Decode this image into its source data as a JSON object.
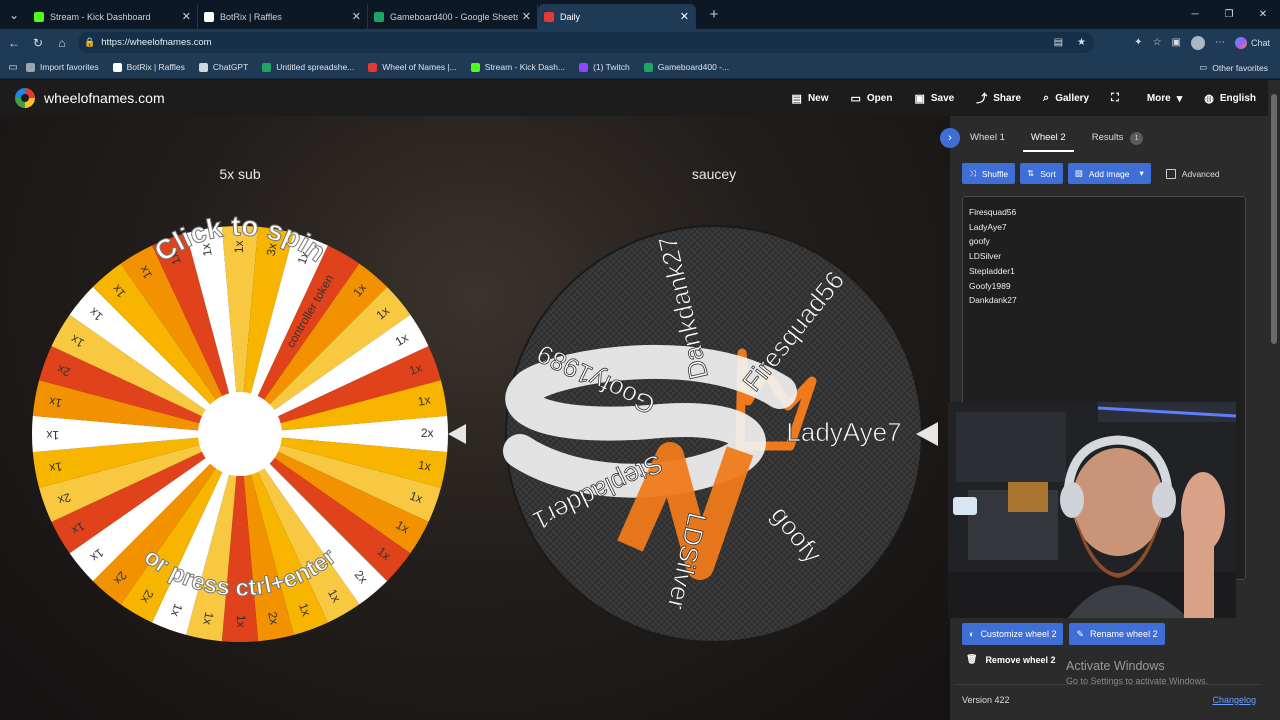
{
  "browser": {
    "tabs": [
      {
        "title": "Stream - Kick Dashboard",
        "color": "#53fc18",
        "active": false
      },
      {
        "title": "BotRix | Raffles",
        "color": "#ffffff",
        "active": false
      },
      {
        "title": "Gameboard400 - Google Sheets",
        "color": "#1fa463",
        "active": false
      },
      {
        "title": "Daily",
        "color": "#e53935",
        "active": true
      }
    ],
    "url": "https://wheelofnames.com",
    "chat_label": "Chat",
    "bookmarks": [
      {
        "label": "Import favorites",
        "color": "#9aa5b1"
      },
      {
        "label": "BotRix | Raffles",
        "color": "#ffffff"
      },
      {
        "label": "ChatGPT",
        "color": "#cfd8dc"
      },
      {
        "label": "Untitled spreadshe...",
        "color": "#1fa463"
      },
      {
        "label": "Wheel of Names |...",
        "color": "#e53935"
      },
      {
        "label": "Stream - Kick Dash...",
        "color": "#53fc18"
      },
      {
        "label": "(1) Twitch",
        "color": "#9146ff"
      },
      {
        "label": "Gameboard400 -...",
        "color": "#1fa463"
      }
    ],
    "other_favorites": "Other favorites"
  },
  "app": {
    "logo_text": "wheelofnames.com",
    "menu": [
      {
        "label": "New",
        "icon": "file-icon"
      },
      {
        "label": "Open",
        "icon": "folder-icon"
      },
      {
        "label": "Save",
        "icon": "save-icon"
      },
      {
        "label": "Share",
        "icon": "share-icon"
      },
      {
        "label": "Gallery",
        "icon": "search-icon"
      },
      {
        "label": "",
        "icon": "fullscreen-icon"
      },
      {
        "label": "More",
        "icon": "chevron-down-icon"
      },
      {
        "label": "English",
        "icon": "globe-icon"
      }
    ]
  },
  "wheels": [
    {
      "title": "5x sub",
      "overlay_top": "Click to spin",
      "overlay_bottom": "or press ctrl+enter",
      "pointer_label": "2x",
      "special_label": "controller token",
      "labels": [
        "2x",
        "1x",
        "1x",
        "1x",
        "1x",
        "2x",
        "1x",
        "1x",
        "2x",
        "1x",
        "1x",
        "1x",
        "2x",
        "2x",
        "1x",
        "1x",
        "2x",
        "1x",
        "1x",
        "1x",
        "2x",
        "1x",
        "1x",
        "1x",
        "1x",
        "1x",
        "1x",
        "1x",
        "3x",
        "1x",
        "controller token",
        "1x",
        "1x",
        "1x",
        "1x",
        "1x"
      ],
      "colors": [
        "#ffffff",
        "#f7b500",
        "#f8c840",
        "#f39200",
        "#e0421c",
        "#ffffff",
        "#f8c840",
        "#f7b500",
        "#f39200",
        "#e0421c",
        "#f8c840",
        "#ffffff",
        "#f7b500",
        "#f39200",
        "#ffffff",
        "#e0421c",
        "#f8c840",
        "#f7b500",
        "#ffffff",
        "#f39200",
        "#e0421c",
        "#f8c840",
        "#ffffff",
        "#f7b500",
        "#f39200",
        "#e0421c",
        "#ffffff",
        "#f8c840",
        "#f7b500",
        "#ffffff",
        "#e0421c",
        "#f39200",
        "#f8c840",
        "#ffffff",
        "#e0421c",
        "#f7b500"
      ]
    },
    {
      "title": "saucey",
      "entries": [
        "LadyAye7",
        "goofy",
        "LDSilver",
        "Stepladder1",
        "Goofy1989",
        "Dankdank27",
        "Firesquad56"
      ]
    }
  ],
  "panel": {
    "tabs": [
      {
        "label": "Wheel 1",
        "active": false
      },
      {
        "label": "Wheel 2",
        "active": true
      },
      {
        "label": "Results",
        "active": false,
        "badge": "1"
      }
    ],
    "tools": {
      "shuffle": "Shuffle",
      "sort": "Sort",
      "add_image": "Add image",
      "advanced": "Advanced"
    },
    "entries": [
      "Firesquad56",
      "LadyAye7",
      "goofy",
      "LDSilver",
      "Stepladder1",
      "Goofy1989",
      "Dankdank27"
    ],
    "customize": "Customize wheel 2",
    "rename": "Rename wheel 2",
    "remove": "Remove wheel 2",
    "activate_title": "Activate Windows",
    "activate_sub": "Go to Settings to activate Windows.",
    "version": "Version 422",
    "changelog": "Changelog"
  }
}
